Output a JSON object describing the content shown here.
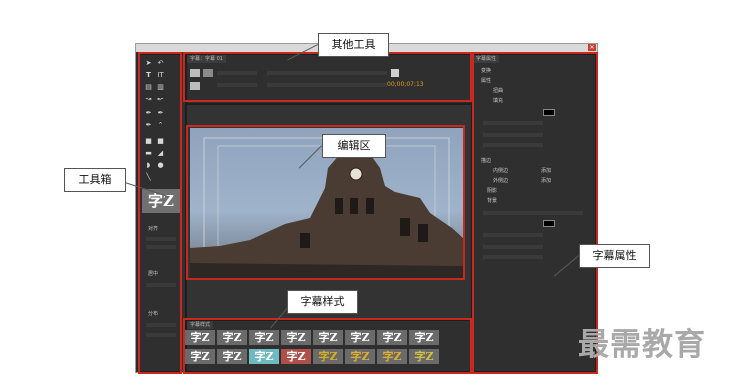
{
  "callouts": {
    "other_tools": "其他工具",
    "edit_area": "编辑区",
    "toolbox": "工具箱",
    "style": "字幕样式",
    "properties": "字幕属性"
  },
  "panels": {
    "title_tab": "字幕：字幕 01",
    "properties_tab": "字幕属性",
    "styles_tab": "字幕样式",
    "timecode": "00;00;07;13"
  },
  "toolbox": {
    "preview_glyph": "字Z",
    "sections": [
      "对齐",
      "居中",
      "分布"
    ]
  },
  "properties": {
    "items": [
      "变换",
      "属性",
      "扭曲",
      "填充",
      "描边",
      "内侧边",
      "外侧边",
      "阴影",
      "背景"
    ],
    "add_labels": [
      "添加",
      "添加"
    ]
  },
  "styles": {
    "row1": [
      "字Z",
      "字Z",
      "字Z",
      "字Z",
      "字Z",
      "字Z",
      "字Z",
      "字Z"
    ],
    "row2": [
      "字Z",
      "字Z",
      "字Z",
      "字Z",
      "字Z",
      "字Z",
      "字Z",
      "字Z"
    ]
  },
  "watermark": "最需教育"
}
